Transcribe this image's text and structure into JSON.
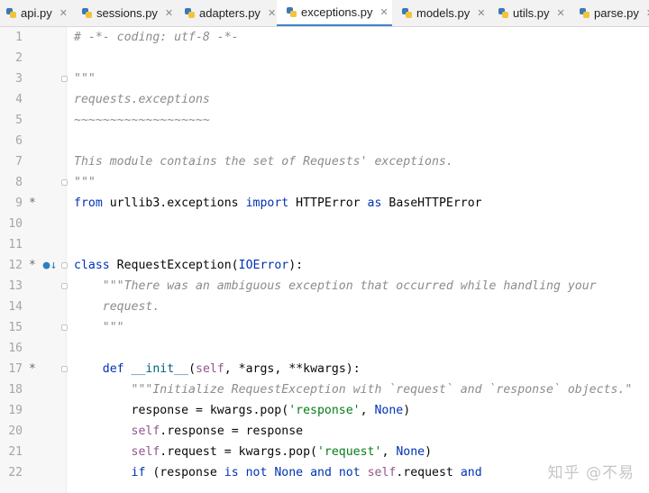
{
  "tabs": [
    {
      "label": "api.py",
      "icon": "python-file-icon",
      "active": false
    },
    {
      "label": "sessions.py",
      "icon": "python-file-icon",
      "active": false
    },
    {
      "label": "adapters.py",
      "icon": "python-file-icon",
      "active": false
    },
    {
      "label": "exceptions.py",
      "icon": "python-file-icon",
      "active": true
    },
    {
      "label": "models.py",
      "icon": "python-file-icon",
      "active": false
    },
    {
      "label": "utils.py",
      "icon": "python-file-icon",
      "active": false
    },
    {
      "label": "parse.py",
      "icon": "python-file-icon",
      "active": false
    }
  ],
  "tab_close_glyph": "✕",
  "editor": {
    "lines": [
      {
        "num": "1",
        "mark": "",
        "tokens": [
          {
            "t": "# -*- coding: utf-8 -*-",
            "c": "cm"
          }
        ]
      },
      {
        "num": "2",
        "mark": "",
        "tokens": []
      },
      {
        "num": "3",
        "mark": "",
        "fold": true,
        "tokens": [
          {
            "t": "\"\"\"",
            "c": "ds"
          }
        ]
      },
      {
        "num": "4",
        "mark": "",
        "tokens": [
          {
            "t": "requests.exceptions",
            "c": "ds"
          }
        ]
      },
      {
        "num": "5",
        "mark": "",
        "tokens": [
          {
            "t": "~~~~~~~~~~~~~~~~~~~",
            "c": "ds"
          }
        ]
      },
      {
        "num": "6",
        "mark": "",
        "tokens": []
      },
      {
        "num": "7",
        "mark": "",
        "tokens": [
          {
            "t": "This module contains the set of Requests' exceptions.",
            "c": "ds"
          }
        ]
      },
      {
        "num": "8",
        "mark": "",
        "fold": true,
        "tokens": [
          {
            "t": "\"\"\"",
            "c": "ds"
          }
        ]
      },
      {
        "num": "9",
        "mark": "*",
        "tokens": [
          {
            "t": "from",
            "c": "kw"
          },
          {
            "t": " urllib3.exceptions ",
            "c": ""
          },
          {
            "t": "import",
            "c": "kw"
          },
          {
            "t": " HTTPError ",
            "c": ""
          },
          {
            "t": "as",
            "c": "kw"
          },
          {
            "t": " BaseHTTPError",
            "c": ""
          }
        ]
      },
      {
        "num": "10",
        "mark": "",
        "tokens": []
      },
      {
        "num": "11",
        "mark": "",
        "tokens": []
      },
      {
        "num": "12",
        "mark": "*",
        "override": "●↓",
        "fold": true,
        "tokens": [
          {
            "t": "class",
            "c": "kw"
          },
          {
            "t": " RequestException(",
            "c": ""
          },
          {
            "t": "IOError",
            "c": "kw"
          },
          {
            "t": "):",
            "c": ""
          }
        ]
      },
      {
        "num": "13",
        "mark": "",
        "fold": true,
        "tokens": [
          {
            "t": "    \"\"\"There was an ambiguous exception that occurred while handling your",
            "c": "ds"
          }
        ]
      },
      {
        "num": "14",
        "mark": "",
        "tokens": [
          {
            "t": "    request.",
            "c": "ds"
          }
        ]
      },
      {
        "num": "15",
        "mark": "",
        "fold": true,
        "tokens": [
          {
            "t": "    \"\"\"",
            "c": "ds"
          }
        ]
      },
      {
        "num": "16",
        "mark": "",
        "tokens": []
      },
      {
        "num": "17",
        "mark": "*",
        "fold": true,
        "tokens": [
          {
            "t": "    ",
            "c": ""
          },
          {
            "t": "def",
            "c": "kw"
          },
          {
            "t": " ",
            "c": ""
          },
          {
            "t": "__init__",
            "c": "fn"
          },
          {
            "t": "(",
            "c": ""
          },
          {
            "t": "self",
            "c": "sf"
          },
          {
            "t": ", *args, **kwargs):",
            "c": ""
          }
        ]
      },
      {
        "num": "18",
        "mark": "",
        "tokens": [
          {
            "t": "        \"\"\"Initialize RequestException with `request` and `response` objects.\"",
            "c": "ds"
          }
        ]
      },
      {
        "num": "19",
        "mark": "",
        "tokens": [
          {
            "t": "        response = kwargs.pop(",
            "c": ""
          },
          {
            "t": "'response'",
            "c": "st"
          },
          {
            "t": ", ",
            "c": ""
          },
          {
            "t": "None",
            "c": "kw"
          },
          {
            "t": ")",
            "c": ""
          }
        ]
      },
      {
        "num": "20",
        "mark": "",
        "tokens": [
          {
            "t": "        ",
            "c": ""
          },
          {
            "t": "self",
            "c": "sf"
          },
          {
            "t": ".response = response",
            "c": ""
          }
        ]
      },
      {
        "num": "21",
        "mark": "",
        "tokens": [
          {
            "t": "        ",
            "c": ""
          },
          {
            "t": "self",
            "c": "sf"
          },
          {
            "t": ".request = kwargs.pop(",
            "c": ""
          },
          {
            "t": "'request'",
            "c": "st"
          },
          {
            "t": ", ",
            "c": ""
          },
          {
            "t": "None",
            "c": "kw"
          },
          {
            "t": ")",
            "c": ""
          }
        ]
      },
      {
        "num": "22",
        "mark": "",
        "tokens": [
          {
            "t": "        ",
            "c": ""
          },
          {
            "t": "if",
            "c": "kw"
          },
          {
            "t": " (response ",
            "c": ""
          },
          {
            "t": "is not None",
            "c": "kw"
          },
          {
            "t": " ",
            "c": ""
          },
          {
            "t": "and not",
            "c": "kw"
          },
          {
            "t": " ",
            "c": ""
          },
          {
            "t": "self",
            "c": "sf"
          },
          {
            "t": ".request ",
            "c": ""
          },
          {
            "t": "and",
            "c": "kw"
          }
        ]
      }
    ]
  },
  "watermark": "知乎 @不易"
}
